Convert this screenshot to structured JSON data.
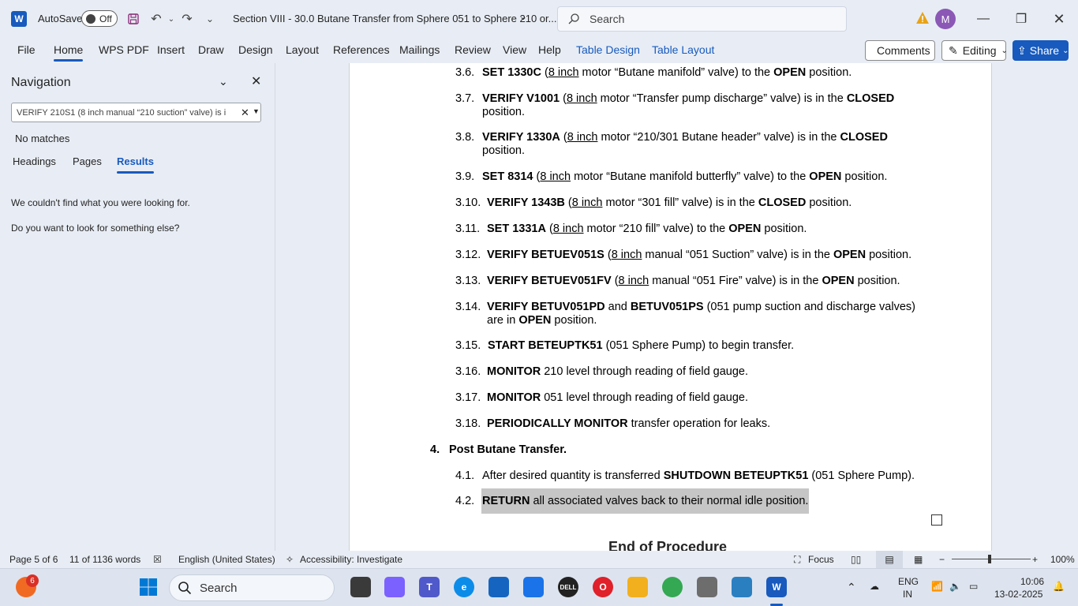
{
  "app": {
    "autosave_label": "AutoSave",
    "autosave_state": "Off",
    "doc_title": "Section VIII - 30.0 Butane Transfer from Sphere 051 to Sphere 210 or...",
    "search_placeholder": "Search",
    "avatar_initial": "M"
  },
  "ribbon": {
    "tabs": [
      "File",
      "Home",
      "WPS PDF",
      "Insert",
      "Draw",
      "Design",
      "Layout",
      "References",
      "Mailings",
      "Review",
      "View",
      "Help",
      "Table Design",
      "Table Layout"
    ],
    "comments": "Comments",
    "editing": "Editing",
    "share": "Share"
  },
  "nav": {
    "title": "Navigation",
    "query": "VERIFY 210S1 (8 inch manual “210 suction” valve) is i",
    "no_matches": "No matches",
    "tabs": [
      "Headings",
      "Pages",
      "Results"
    ],
    "msg1": "We couldn't find what you were looking for.",
    "msg2": "Do you want to look for something else?"
  },
  "doc": {
    "steps": [
      {
        "num": "3.6.",
        "b1": "SET 1330C",
        "t1": " (",
        "u": "8 inch",
        "t2": " motor “Butane manifold” valve) to the ",
        "b2": "OPEN",
        "t3": " position."
      },
      {
        "num": "3.7.",
        "b1": "VERIFY V1001",
        "t1": " (",
        "u": "8 inch",
        "t2": " motor “Transfer pump discharge” valve) is in the ",
        "b2": "CLOSED",
        "t3": "",
        "cont": "position."
      },
      {
        "num": "3.8.",
        "b1": "VERIFY 1330A",
        "t1": " (",
        "u": "8 inch",
        "t2": " motor “210/301 Butane header” valve) is in the ",
        "b2": "CLOSED",
        "t3": "",
        "cont": "position."
      },
      {
        "num": "3.9.",
        "b1": "SET 8314",
        "t1": " (",
        "u": "8 inch",
        "t2": " motor “Butane manifold butterfly” valve) to the ",
        "b2": "OPEN",
        "t3": " position."
      },
      {
        "num": "3.10.",
        "b1": "VERIFY 1343B",
        "t1": " (",
        "u": "8 inch",
        "t2": " motor “301 fill” valve) is in the ",
        "b2": "CLOSED",
        "t3": " position."
      },
      {
        "num": "3.11.",
        "b1": "SET 1331A",
        "t1": " (",
        "u": "8 inch",
        "t2": " motor “210 fill” valve) to the ",
        "b2": "OPEN",
        "t3": " position."
      },
      {
        "num": "3.12.",
        "b1": "VERIFY BETUEV051S",
        "t1": " (",
        "u": "8 inch",
        "t2": " manual “051 Suction” valve) is in the ",
        "b2": "OPEN",
        "t3": " position."
      },
      {
        "num": "3.13.",
        "b1": "VERIFY BETUEV051FV",
        "t1": " (",
        "u": "8 inch",
        "t2": " manual “051 Fire” valve) is in the ",
        "b2": "OPEN",
        "t3": " position."
      }
    ],
    "s314": {
      "num": "3.14.",
      "b1": "VERIFY BETUV051PD",
      "t1": " and ",
      "b2": "BETUV051PS",
      "t2": " (051 pump suction and discharge valves)",
      "c1": "are in ",
      "cb": "OPEN",
      "c2": " position."
    },
    "s315": {
      "num": "3.15.",
      "b": "START BETEUPTK51",
      "t": " (051 Sphere Pump) to begin transfer."
    },
    "s316": {
      "num": "3.16.",
      "b": "MONITOR",
      "t": " 210 level through reading of field gauge."
    },
    "s317": {
      "num": "3.17.",
      "b": "MONITOR",
      "t": " 051 level through reading of field gauge."
    },
    "s318": {
      "num": "3.18.",
      "b": "PERIODICALLY MONITOR",
      "t": " transfer operation for leaks."
    },
    "h4": {
      "num": "4.",
      "t": "Post Butane Transfer."
    },
    "s41": {
      "num": "4.1.",
      "t": "After desired quantity is transferred ",
      "b": "SHUTDOWN BETEUPTK51",
      "t2": " (051 Sphere Pump)."
    },
    "s42": {
      "num": "4.2.",
      "b": "RETURN",
      "t": " all associated valves back to their normal idle position."
    },
    "end": "End of Procedure"
  },
  "status": {
    "page": "Page 5 of 6",
    "words": "11 of 1136 words",
    "lang": "English (United States)",
    "access": "Accessibility: Investigate",
    "focus": "Focus",
    "zoom": "100%"
  },
  "taskbar": {
    "search": "Search",
    "badge": "6",
    "lang1": "ENG",
    "lang2": "IN",
    "time": "10:06",
    "date": "13-02-2025"
  }
}
